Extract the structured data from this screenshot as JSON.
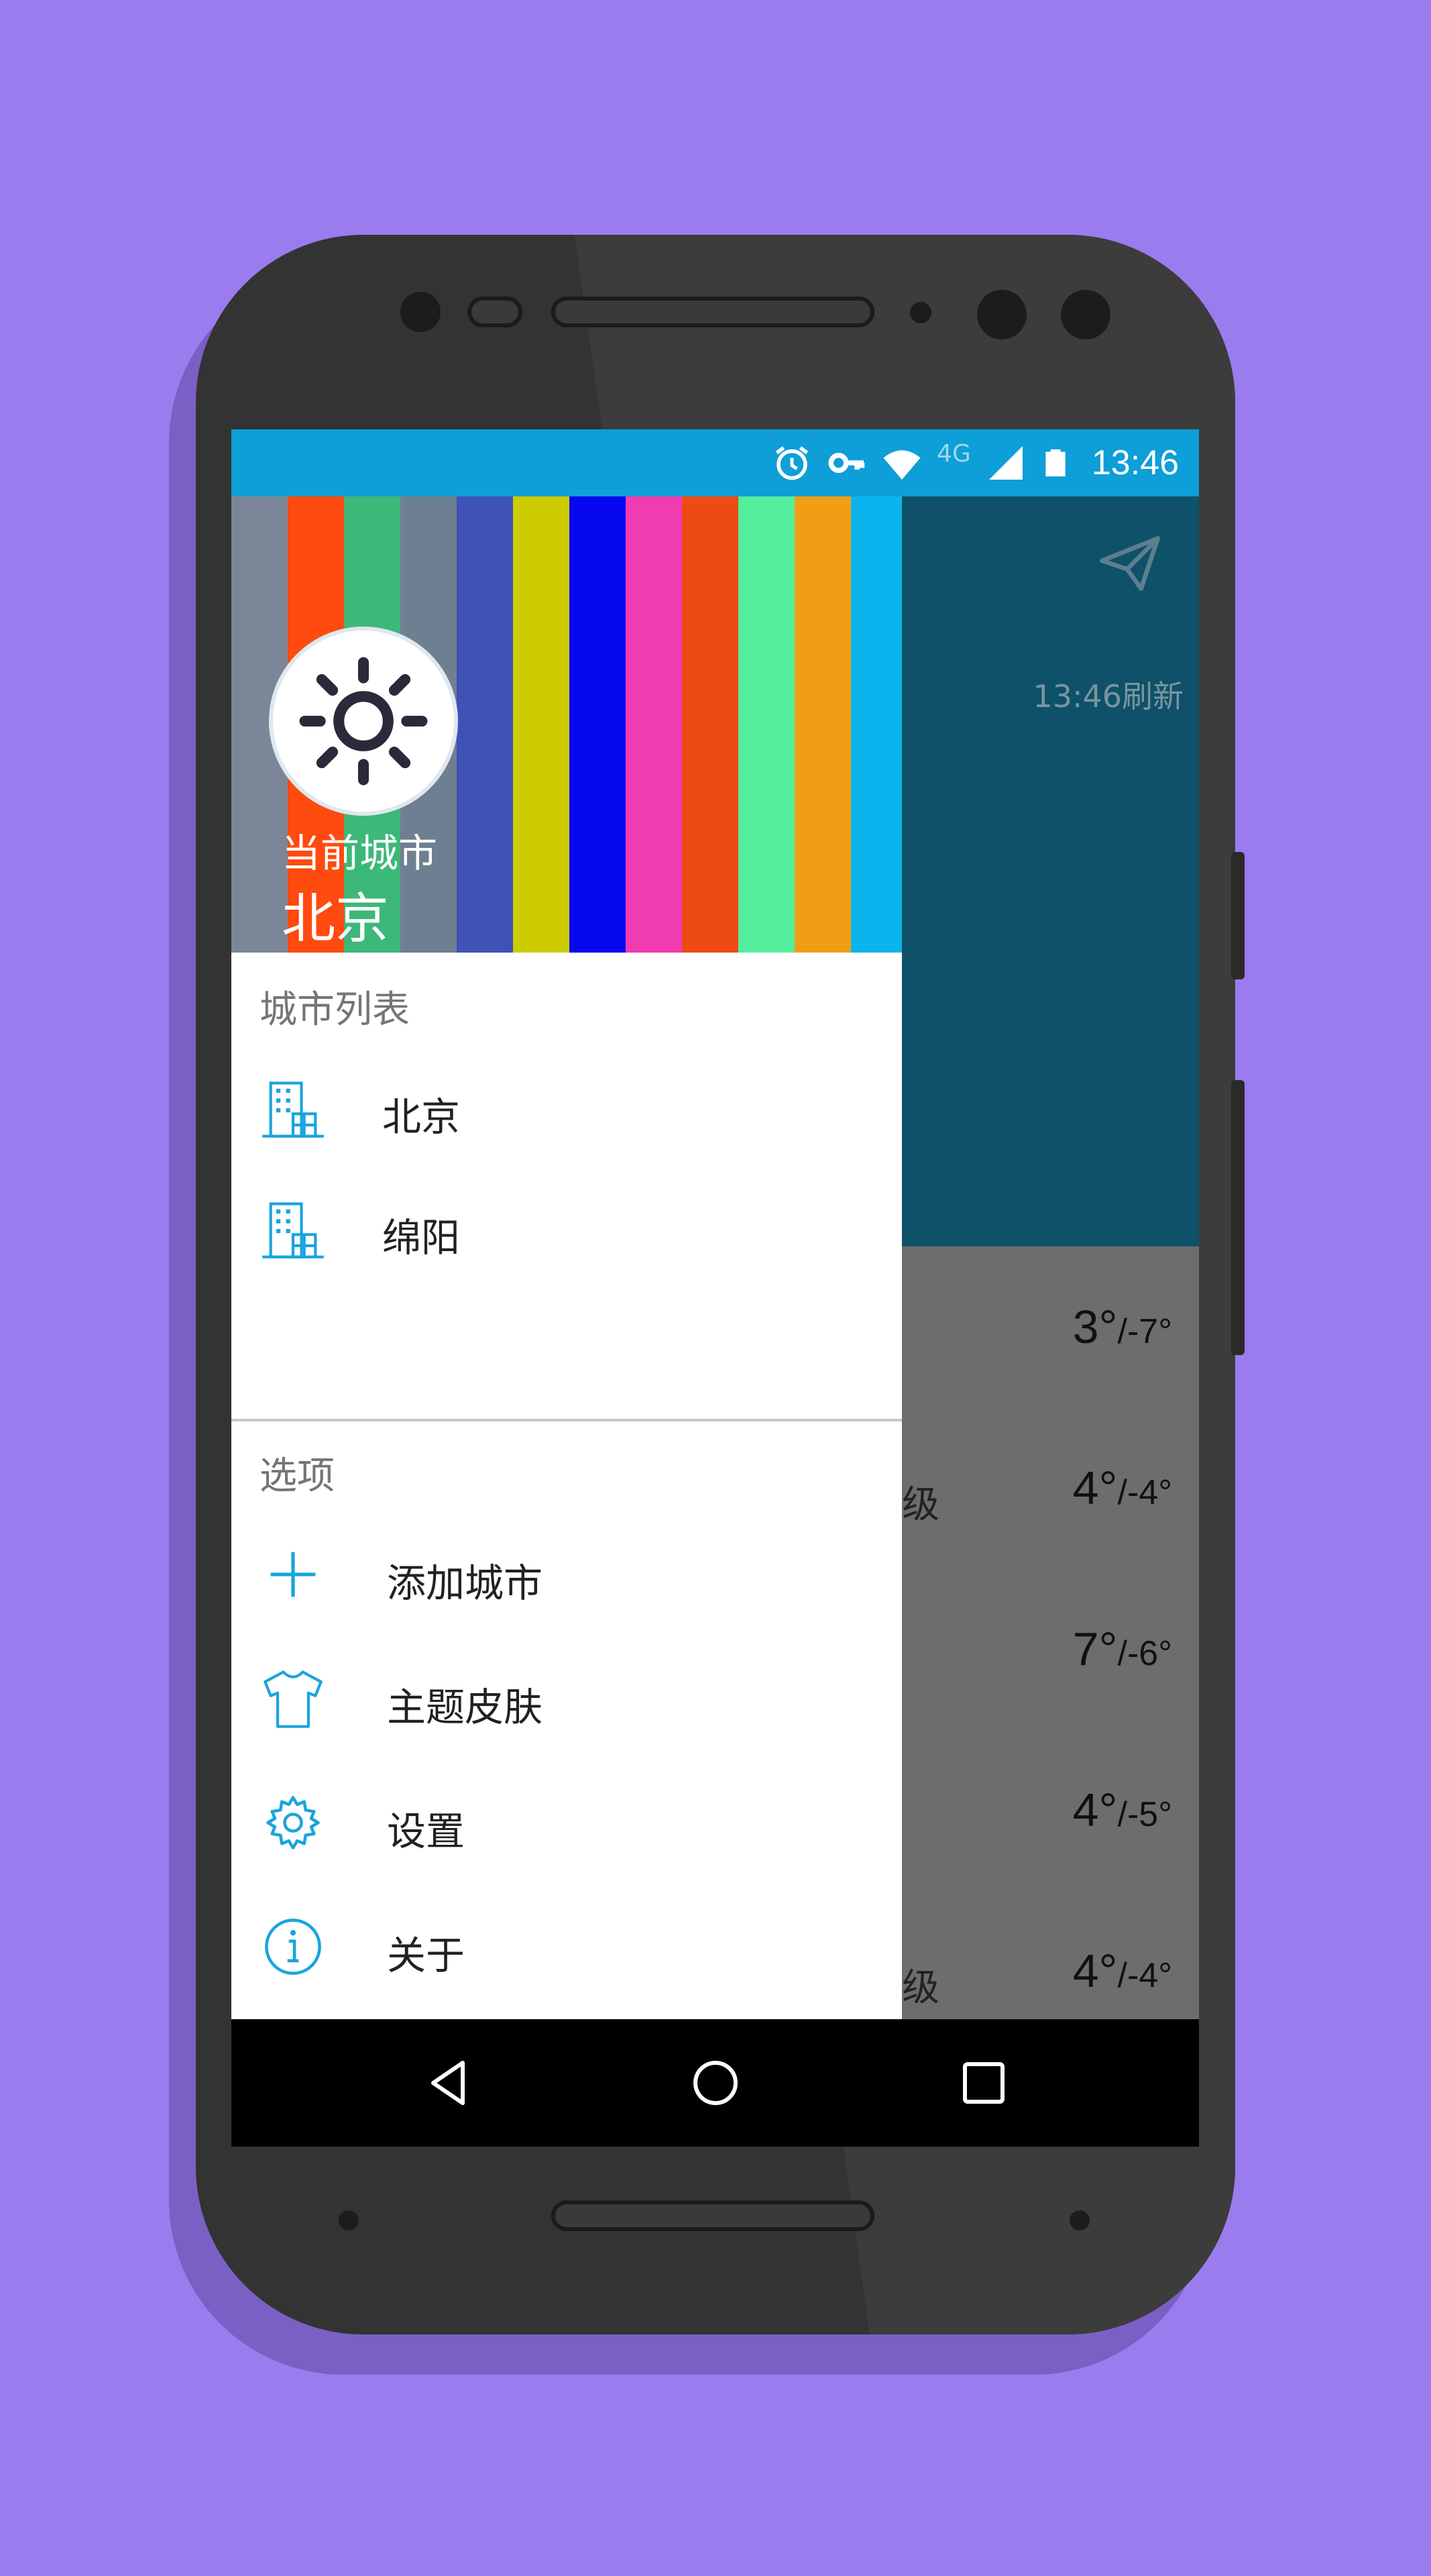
{
  "status_bar": {
    "network_label": "4G",
    "time": "13:46",
    "icons": [
      "alarm-icon",
      "key-icon",
      "wifi-icon",
      "signal-icon",
      "battery-icon"
    ]
  },
  "header": {
    "refresh_text": "13:46刷新",
    "send_icon": "send-icon"
  },
  "forecast": [
    {
      "level": "",
      "high": "3°",
      "low": "/-7°"
    },
    {
      "level": "级",
      "high": "4°",
      "low": "/-4°"
    },
    {
      "level": "",
      "high": "7°",
      "low": "/-6°"
    },
    {
      "level": "",
      "high": "4°",
      "low": "/-5°"
    },
    {
      "level": "级",
      "high": "4°",
      "low": "/-4°"
    }
  ],
  "drawer": {
    "banner": {
      "current_city_label": "当前城市",
      "current_city": "北京",
      "avatar_icon": "sun-icon",
      "stripe_colors": [
        "#7b8798",
        "#ff4a10",
        "#3cb878",
        "#6f7f92",
        "#3f52b5",
        "#cccc00",
        "#0808f0",
        "#f03cb0",
        "#ee4b14",
        "#53ee9c",
        "#f09e14",
        "#0cb4ee"
      ]
    },
    "city_list": {
      "title": "城市列表",
      "items": [
        {
          "label": "北京",
          "icon": "building-icon"
        },
        {
          "label": "绵阳",
          "icon": "building-icon"
        }
      ]
    },
    "options": {
      "title": "选项",
      "items": [
        {
          "label": "添加城市",
          "icon": "plus-icon"
        },
        {
          "label": "主题皮肤",
          "icon": "shirt-icon"
        },
        {
          "label": "设置",
          "icon": "gear-icon"
        },
        {
          "label": "关于",
          "icon": "info-icon"
        }
      ]
    }
  },
  "nav_bar": {
    "icons": [
      "back-icon",
      "home-icon",
      "recents-icon"
    ]
  },
  "colors": {
    "accent": "#0e9ed8",
    "header_dark": "#0e5169",
    "page_background": "#9b7cee"
  }
}
